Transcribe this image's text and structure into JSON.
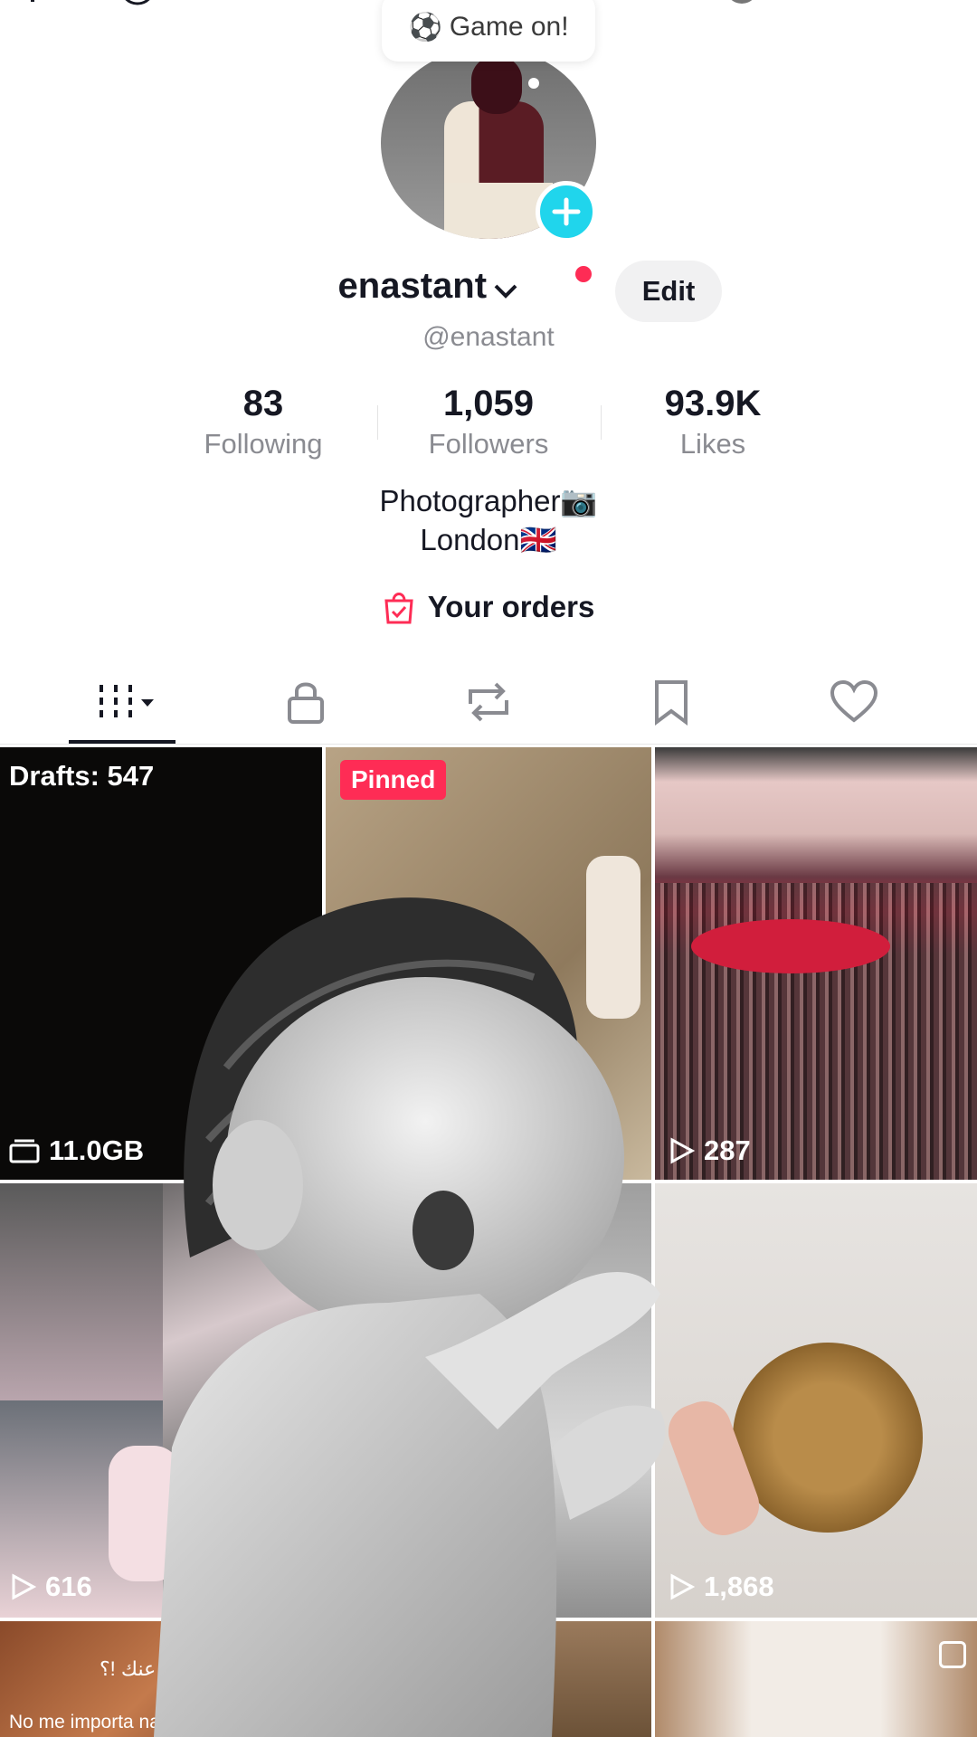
{
  "status_bubble": {
    "emoji": "⚽",
    "text": "Game on!"
  },
  "profile": {
    "name": "enastant",
    "handle": "@enastant",
    "edit_label": "Edit",
    "stats": [
      {
        "value": "83",
        "label": "Following"
      },
      {
        "value": "1,059",
        "label": "Followers"
      },
      {
        "value": "93.9K",
        "label": "Likes"
      }
    ],
    "bio_line1": "Photographer📷",
    "bio_line2": "London🇬🇧",
    "orders_label": "Your orders"
  },
  "tabs": [
    "videos-grid",
    "private",
    "reposts",
    "favorites",
    "liked"
  ],
  "grid": {
    "drafts_label": "Drafts: 547",
    "drafts_size": "11.0GB",
    "pinned_label": "Pinned",
    "views": {
      "concert": "287",
      "collage": "616",
      "coffee": "1,868"
    },
    "caption_arabic": "قالو عنك !؟",
    "caption_spanish": "No me importa naaaaaa"
  },
  "colors": {
    "accent": "#fe2c55",
    "plus": "#20d5ec"
  }
}
